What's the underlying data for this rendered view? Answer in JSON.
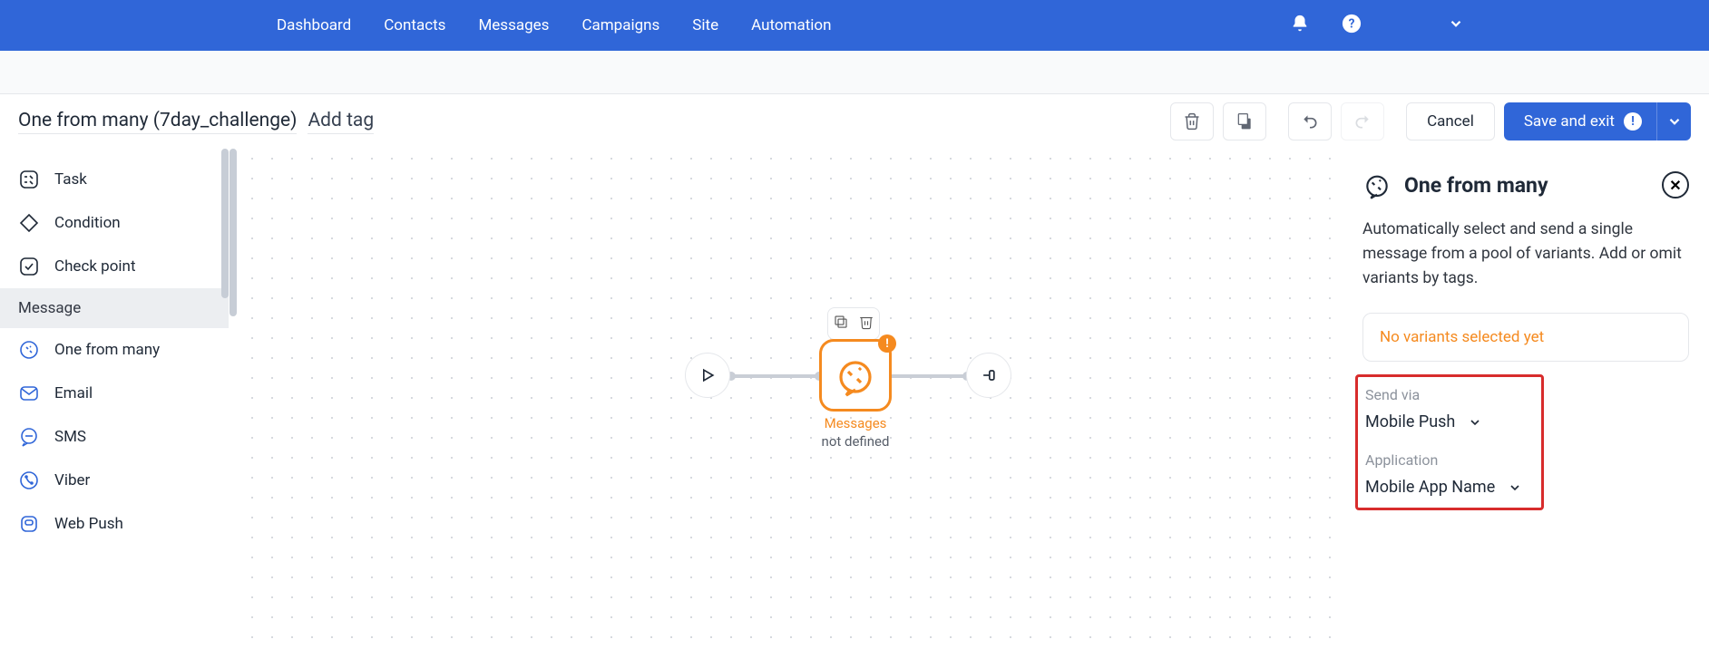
{
  "nav": {
    "links": [
      "Dashboard",
      "Contacts",
      "Messages",
      "Campaigns",
      "Site",
      "Automation"
    ]
  },
  "title": "One from many (7day_challenge)",
  "add_tag_label": "Add tag",
  "actions": {
    "cancel": "Cancel",
    "save": "Save and exit"
  },
  "sidebar": {
    "items": [
      {
        "icon": "task",
        "label": "Task"
      },
      {
        "icon": "condition",
        "label": "Condition"
      },
      {
        "icon": "checkpoint",
        "label": "Check point"
      }
    ],
    "heading": "Message",
    "message_items": [
      {
        "icon": "one-from-many",
        "label": "One from many"
      },
      {
        "icon": "email",
        "label": "Email"
      },
      {
        "icon": "sms",
        "label": "SMS"
      },
      {
        "icon": "viber",
        "label": "Viber"
      },
      {
        "icon": "webpush",
        "label": "Web Push"
      }
    ]
  },
  "canvas": {
    "caption_line1": "Messages",
    "caption_line2": "not defined",
    "warning_badge": "!"
  },
  "panel": {
    "title": "One from many",
    "description": "Automatically select and send a single message from a pool of variants. Add or omit variants by tags.",
    "warning": "No variants selected yet",
    "send_via_label": "Send via",
    "send_via_value": "Mobile Push",
    "application_label": "Application",
    "application_value": "Mobile App Name"
  }
}
